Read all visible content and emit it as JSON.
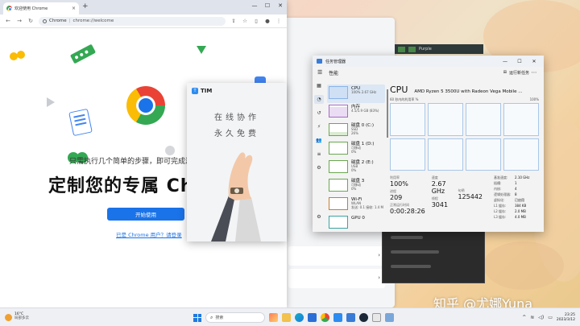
{
  "chrome": {
    "tab_title": "欢迎使用 Chrome",
    "tab_close": "×",
    "new_tab": "+",
    "win_min": "—",
    "win_max": "☐",
    "win_close": "✕",
    "nav_back": "←",
    "nav_forward": "→",
    "nav_reload": "↻",
    "omnibox_label": "Chrome",
    "omnibox_sep": "|",
    "omnibox_url": "chrome://welcome",
    "tagline": "只需执行几个简单的步骤，即可完成浏",
    "title": "定制您的专属 Ch",
    "start_button": "开始使用",
    "signin_link": "已是 Chrome 用户？请登录"
  },
  "tim": {
    "logo_letter": "T",
    "name": "TIM",
    "slogan_1": "在线协作",
    "slogan_2": "永久免费"
  },
  "taskmgr": {
    "window_title": "任务管理器",
    "section": "性能",
    "run_task": "运行新任务",
    "more": "⋯",
    "items": [
      {
        "name": "CPU",
        "sub": "100%  2.67 GHz"
      },
      {
        "name": "内存",
        "sub": "4.5/5.9 GB (83%)"
      },
      {
        "name": "磁盘 0 (C:)",
        "sub": "SSD",
        "sub2": "26%"
      },
      {
        "name": "磁盘 1 (D:)",
        "sub": "可移动",
        "sub2": "0%"
      },
      {
        "name": "磁盘 2 (E:)",
        "sub": "USB",
        "sub2": "0%"
      },
      {
        "name": "磁盘 3",
        "sub": "可移动",
        "sub2": "0%"
      },
      {
        "name": "Wi-Fi",
        "sub": "WLAN",
        "sub2": "发送: 0.1  接收: 1.4 M"
      },
      {
        "name": "GPU 0",
        "sub": ""
      }
    ],
    "detail_title": "CPU",
    "detail_model": "AMD Ryzen 5 3500U with Radeon Vega Mobile ...",
    "axis_left": "60 秒内的利用率 %",
    "axis_right": "100%",
    "stats": {
      "util_label": "利用率",
      "util_value": "100%",
      "speed_label": "速度",
      "speed_value": "2.67 GHz",
      "proc_label": "进程",
      "proc_value": "209",
      "threads_label": "线程",
      "threads_value": "3041",
      "handles_label": "句柄",
      "handles_value": "125442",
      "uptime_label": "正常运行时间",
      "uptime_value": "0:00:28:26"
    },
    "specs": [
      {
        "k": "基准速度:",
        "v": "2.10 GHz"
      },
      {
        "k": "插槽:",
        "v": "1"
      },
      {
        "k": "内核:",
        "v": "4"
      },
      {
        "k": "逻辑处理器:",
        "v": "8"
      },
      {
        "k": "虚拟化:",
        "v": "已启用"
      },
      {
        "k": "L1 缓存:",
        "v": "384 KB"
      },
      {
        "k": "L2 缓存:",
        "v": "2.0 MB"
      },
      {
        "k": "L3 缓存:",
        "v": "4.0 MB"
      }
    ]
  },
  "darkbar_text": "Purple",
  "watermark": "知乎 @尤娜Yuna",
  "taskbar": {
    "weather_temp": "16°C",
    "weather_desc": "局部多云",
    "search_placeholder": "搜索",
    "time": "23:25",
    "date": "2023/3/12"
  },
  "colors": {
    "chrome_blue": "#1a73e8",
    "tm_cpu": "#8ab4e8",
    "accent": "#1f7ae0"
  }
}
